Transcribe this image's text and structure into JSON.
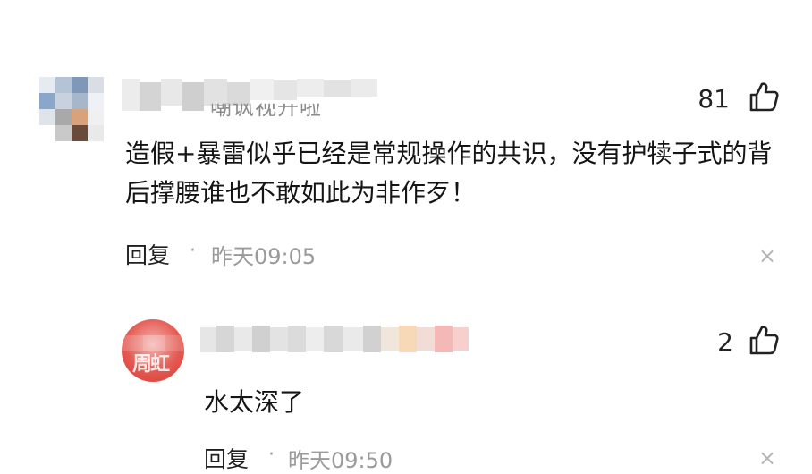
{
  "comment1": {
    "username_fragment": "嘲讽视开啦",
    "likes": "81",
    "text": "造假+暴雷似乎已经是常规操作的共识，没有护犊子式的背后撑腰谁也不敢如此为非作歹！",
    "reply_label": "回复",
    "separator": "·",
    "time": "昨天09:05",
    "close": "×"
  },
  "comment2": {
    "avatar_text": "周虹",
    "likes": "2",
    "text": "水太深了",
    "reply_label": "回复",
    "separator": "·",
    "time": "昨天09:50"
  },
  "colors": {
    "text": "#151515",
    "meta": "#9a9a9a",
    "avatar2": "#e45a52"
  },
  "icons": {
    "like": "thumbs-up-icon",
    "close": "close-icon"
  }
}
